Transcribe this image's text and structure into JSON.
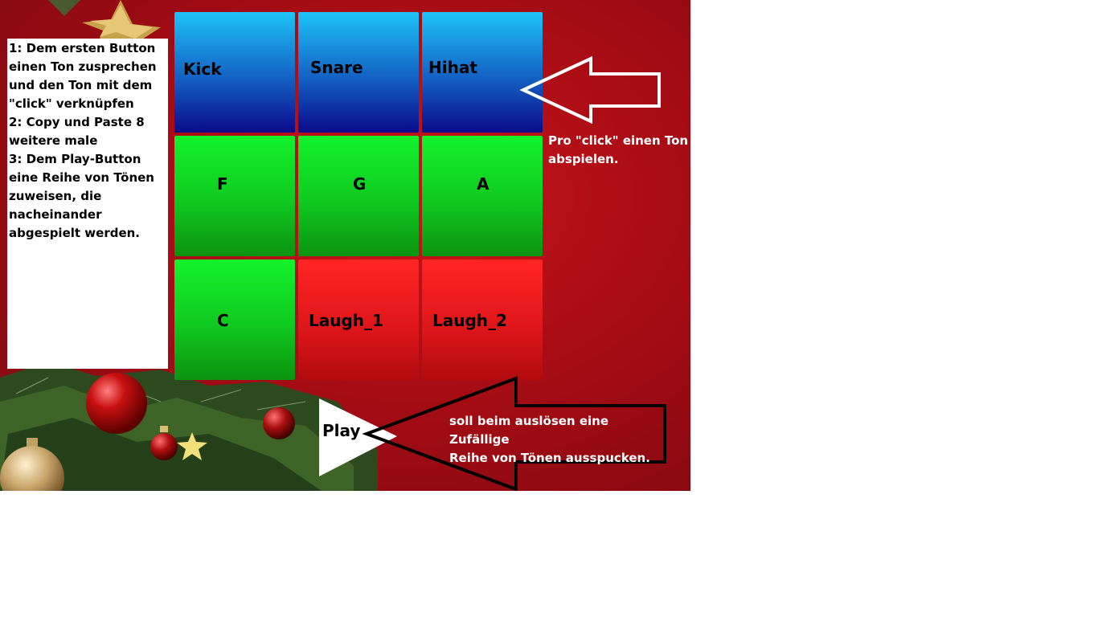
{
  "instructions": {
    "text": "1: Dem ersten Button einen Ton zusprechen und den Ton mit dem \"click\" verknüpfen\n2: Copy und Paste 8 weitere male\n3: Dem Play-Button eine Reihe von Tönen zuweisen, die nacheinander abgespielt werden."
  },
  "pads": {
    "kick": "Kick",
    "snare": "Snare",
    "hihat": "Hihat",
    "f": "F",
    "g": "G",
    "a": "A",
    "c": "C",
    "laugh1": "Laugh_1",
    "laugh2": "Laugh_2"
  },
  "play": {
    "label": "Play"
  },
  "annotations": {
    "click_caption": "Pro \"click\" einen Ton\nabspielen.",
    "play_caption": "soll beim auslösen eine Zufällige\nReihe von Tönen ausspucken."
  },
  "colors": {
    "background": "#a80c14",
    "blue_pad": "#1360c4",
    "green_pad": "#0fc91f",
    "red_pad": "#e0161a"
  }
}
